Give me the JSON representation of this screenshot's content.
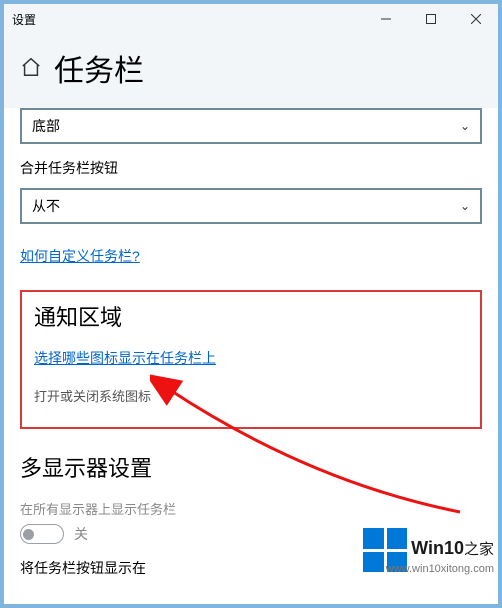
{
  "window": {
    "title": "设置"
  },
  "title": "任务栏",
  "taskbar_position_value": "底部",
  "combine_buttons_label": "合并任务栏按钮",
  "combine_buttons_value": "从不",
  "customize_link": "如何自定义任务栏?",
  "notification": {
    "heading": "通知区域",
    "select_icons_link": "选择哪些图标显示在任务栏上",
    "system_icons_text": "打开或关闭系统图标"
  },
  "multi_monitor": {
    "heading": "多显示器设置",
    "show_on_all": "在所有显示器上显示任务栏",
    "toggle_off": "关",
    "show_buttons_label": "将任务栏按钮显示在"
  },
  "watermark": {
    "brand": "Win10",
    "suffix": "之家",
    "url": "www.win10xitong.com"
  }
}
